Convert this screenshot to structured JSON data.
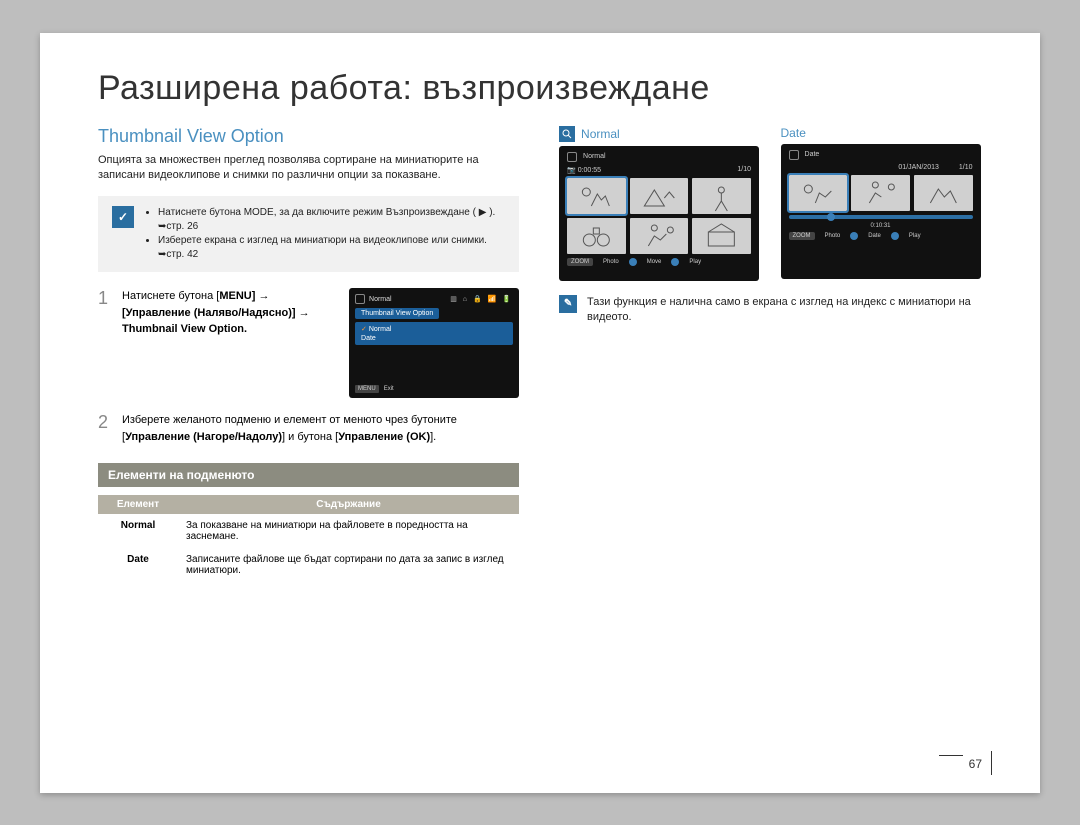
{
  "page_title": "Разширена работа: възпроизвеждане",
  "section_title": "Thumbnail View Option",
  "intro": "Опцията за множествен преглед позволява сортиране на миниатюрите на записани видеоклипове и снимки по различни опции за показване.",
  "note_icon": "✓",
  "notes": [
    "Натиснете бутона MODE, за да включите режим Възпроизвеждане ( ▶ ). ➥стр. 26",
    "Изберете екрана с изглед на миниатюри на видеоклипове или снимки. ➥стр. 42"
  ],
  "steps": [
    {
      "num": "1",
      "text_a": "Натиснете бутона [",
      "text_b": "MENU",
      "text_c": "] → [Управление (Наляво/Надясно)] → Thumbnail View Option."
    },
    {
      "num": "2",
      "text_a": "Изберете желаното подменю и елемент от менюто чрез бутоните [",
      "text_b": "Управление (Нагоре/Надолу)",
      "text_c": "] и бутона [",
      "text_d": "Управление (OK)",
      "text_e": "]."
    }
  ],
  "menu_screen": {
    "top_label": "Normal",
    "tag": "Thumbnail View Option",
    "opt_sel": "Normal",
    "opt2": "Date",
    "exit_btn": "MENU",
    "exit_txt": "Exit"
  },
  "normal_preview": {
    "label": "Normal",
    "header": "Normal",
    "clock": "0:00:55",
    "counter": "1/10",
    "zoom": "ZOOM",
    "foot1": "Photo",
    "foot2": "Move",
    "foot3": "Play"
  },
  "date_preview": {
    "label": "Date",
    "header": "Date",
    "dateval": "01/JAN/2013",
    "counter": "1/10",
    "time": "0:10:31",
    "zoom": "ZOOM",
    "foot1": "Photo",
    "foot2": "Date",
    "foot3": "Play"
  },
  "right_note": "Тази функция е налична само в екрана с изглед на индекс с миниатюри на видеото.",
  "submenu_heading": "Елементи на подменюто",
  "table": {
    "col1": "Елемент",
    "col2": "Съдържание",
    "rows": [
      {
        "el": "Normal",
        "desc": "За показване на миниатюри на файловете в поредността на заснемане."
      },
      {
        "el": "Date",
        "desc": "Записаните файлове ще бъдат сортирани по дата за запис в изглед миниатюри."
      }
    ]
  },
  "page_number": "67"
}
